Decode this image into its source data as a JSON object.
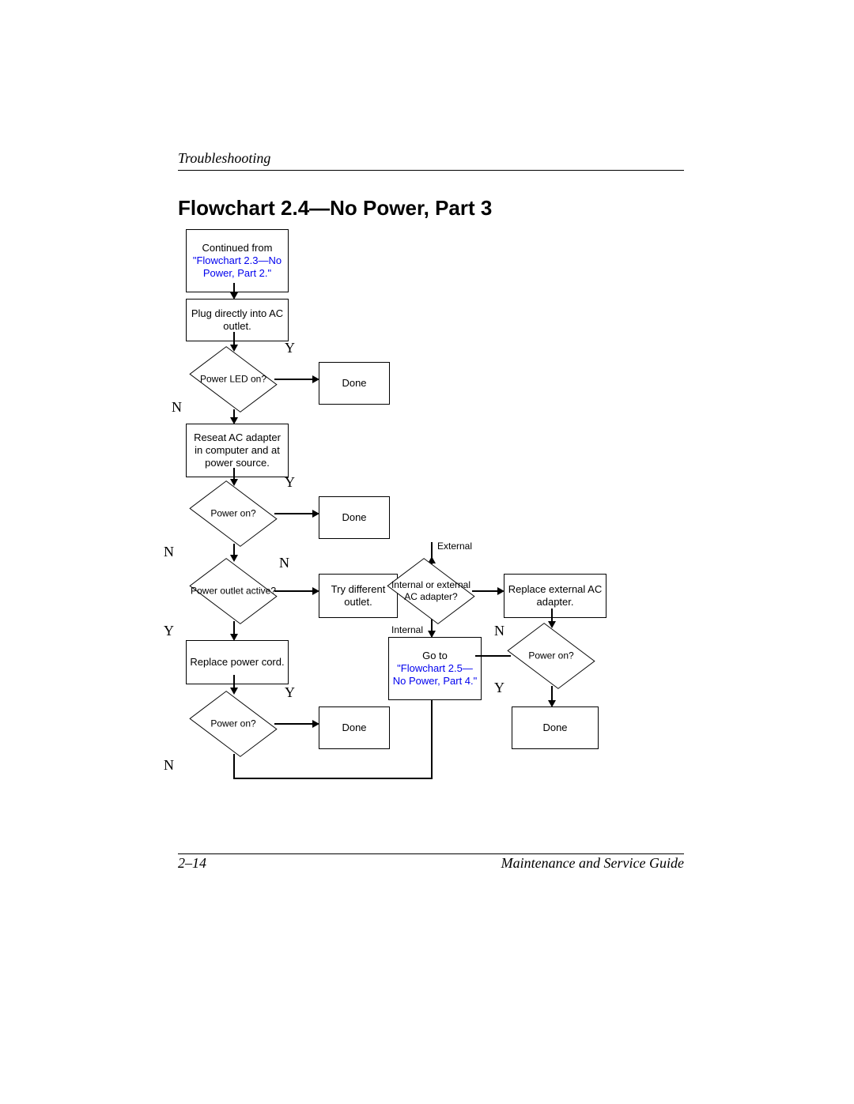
{
  "header": {
    "section": "Troubleshooting"
  },
  "title": "Flowchart 2.4—No Power, Part 3",
  "nodes": {
    "start": {
      "prefix": "Continued from",
      "link": "\"Flowchart 2.3—No Power, Part 2.\""
    },
    "plug": "Plug directly into AC outlet.",
    "led": "Power LED on?",
    "done1": "Done",
    "reseat": "Reseat AC adapter in computer and at power source.",
    "poweron1": "Power on?",
    "done2": "Done",
    "outlet": "Power outlet active?",
    "tryoutlet": "Try different outlet.",
    "replacecord": "Replace power cord.",
    "poweron2": "Power on?",
    "done3": "Done",
    "adapter": "Internal or external AC adapter?",
    "replaceext": "Replace external AC adapter.",
    "goto": {
      "prefix": "Go to",
      "link": "\"Flowchart 2.5—No Power, Part 4.\""
    },
    "poweron3": "Power on?",
    "done4": "Done"
  },
  "labels": {
    "Y": "Y",
    "N": "N",
    "External": "External",
    "Internal": "Internal"
  },
  "footer": {
    "page": "2–14",
    "doc": "Maintenance and Service Guide"
  }
}
